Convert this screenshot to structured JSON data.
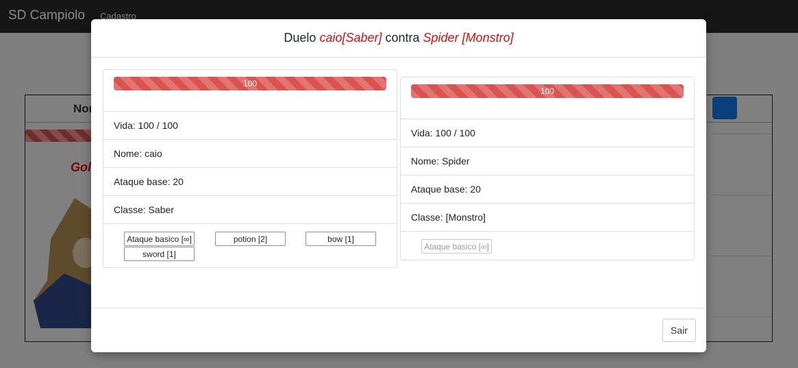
{
  "navbar": {
    "brand": "SD Campiolo",
    "link": "Cadastro"
  },
  "background": {
    "table_header_partial": "Nom",
    "gold_partial": "Gol"
  },
  "modal": {
    "title": {
      "prefix": "Duelo ",
      "player_name": "caio[Saber]",
      "middle": " contra ",
      "enemy_name": "Spider [Monstro]"
    },
    "player": {
      "hp_value": 100,
      "hp_label": "100",
      "vida": "Vida: 100 / 100",
      "nome": "Nome: caio",
      "ataque": "Ataque base: 20",
      "classe": "Classe: Saber",
      "actions": [
        "Ataque basico [∞]",
        "potion [2]",
        "bow [1]",
        "sword [1]"
      ]
    },
    "enemy": {
      "hp_value": 100,
      "hp_label": "100",
      "vida": "Vida: 100 / 100",
      "nome": "Nome: Spider",
      "ataque": "Ataque base: 20",
      "classe": "Classe: [Monstro]",
      "actions": [
        "Ataque basico [∞]"
      ]
    },
    "exit_label": "Sair"
  },
  "colors": {
    "accent_red": "#e00d0d",
    "hp_bar": "#d9534f",
    "navbar": "#161616"
  }
}
